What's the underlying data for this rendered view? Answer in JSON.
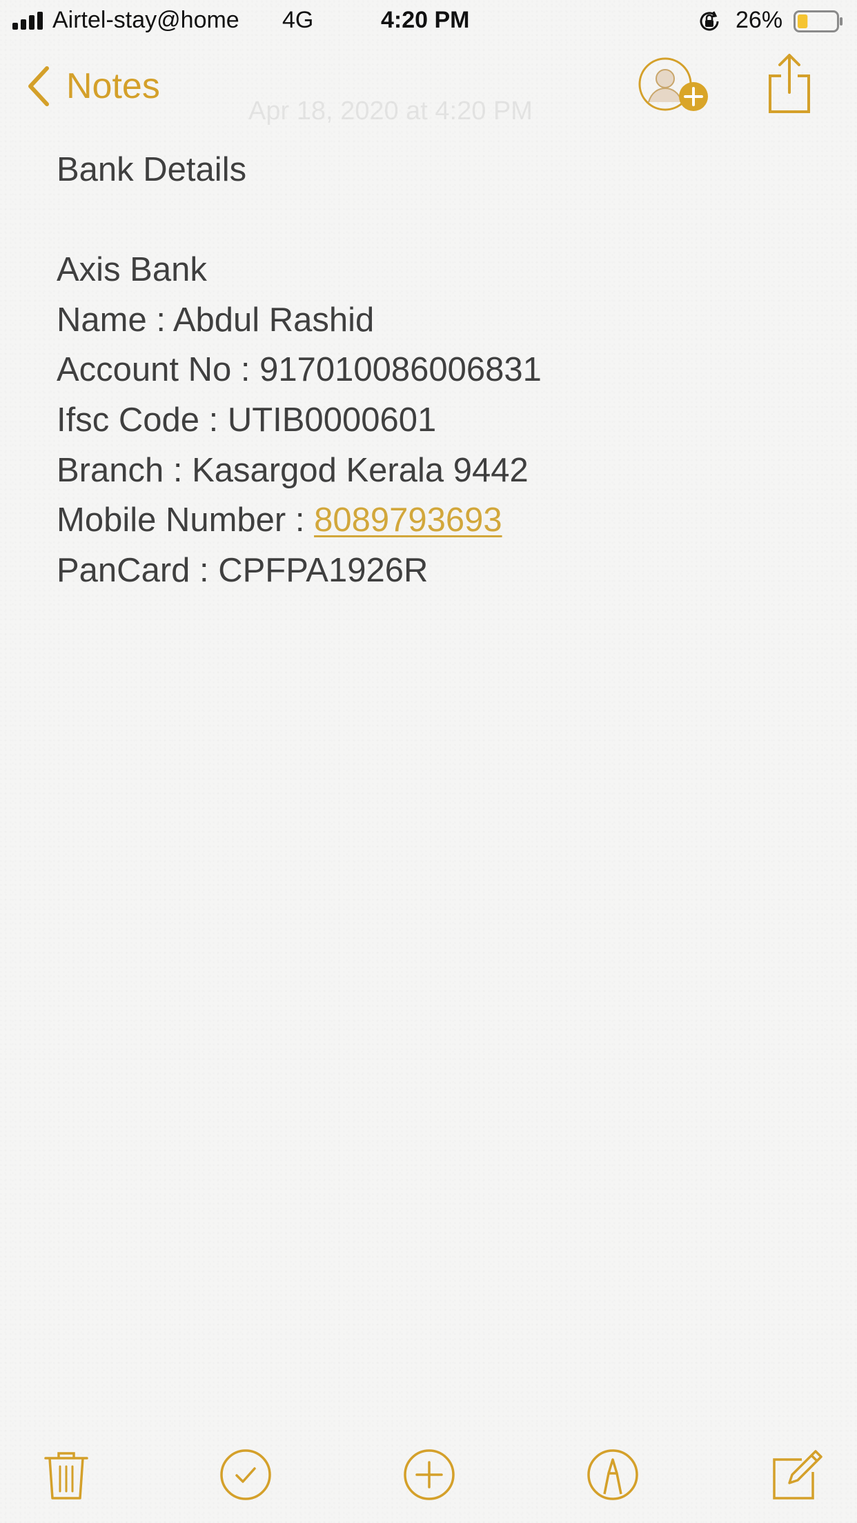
{
  "status_bar": {
    "carrier": "Airtel-stay@home",
    "network": "4G",
    "time": "4:20 PM",
    "battery_percent": "26%",
    "battery_level": 0.26,
    "battery_color": "#f5c431"
  },
  "nav": {
    "back_label": "Notes",
    "faded_title": "Apr 18, 2020 at 4:20 PM",
    "accent_color": "#d4a02a",
    "icons": [
      "chevron-left-icon",
      "add-person-icon",
      "share-icon"
    ]
  },
  "note": {
    "title": "Bank Details",
    "bank": "Axis Bank",
    "name_line": "Name : Abdul Rashid",
    "account_line": "Account No : 917010086006831",
    "ifsc_line": "Ifsc Code : UTIB0000601",
    "branch_line": "Branch : Kasargod Kerala 9442",
    "mobile_label": "Mobile Number : ",
    "mobile_number": "8089793693",
    "pancard_line": "PanCard : CPFPA1926R"
  },
  "toolbar": {
    "icons": [
      "trash-icon",
      "checklist-icon",
      "add-icon",
      "markup-icon",
      "compose-icon"
    ]
  }
}
